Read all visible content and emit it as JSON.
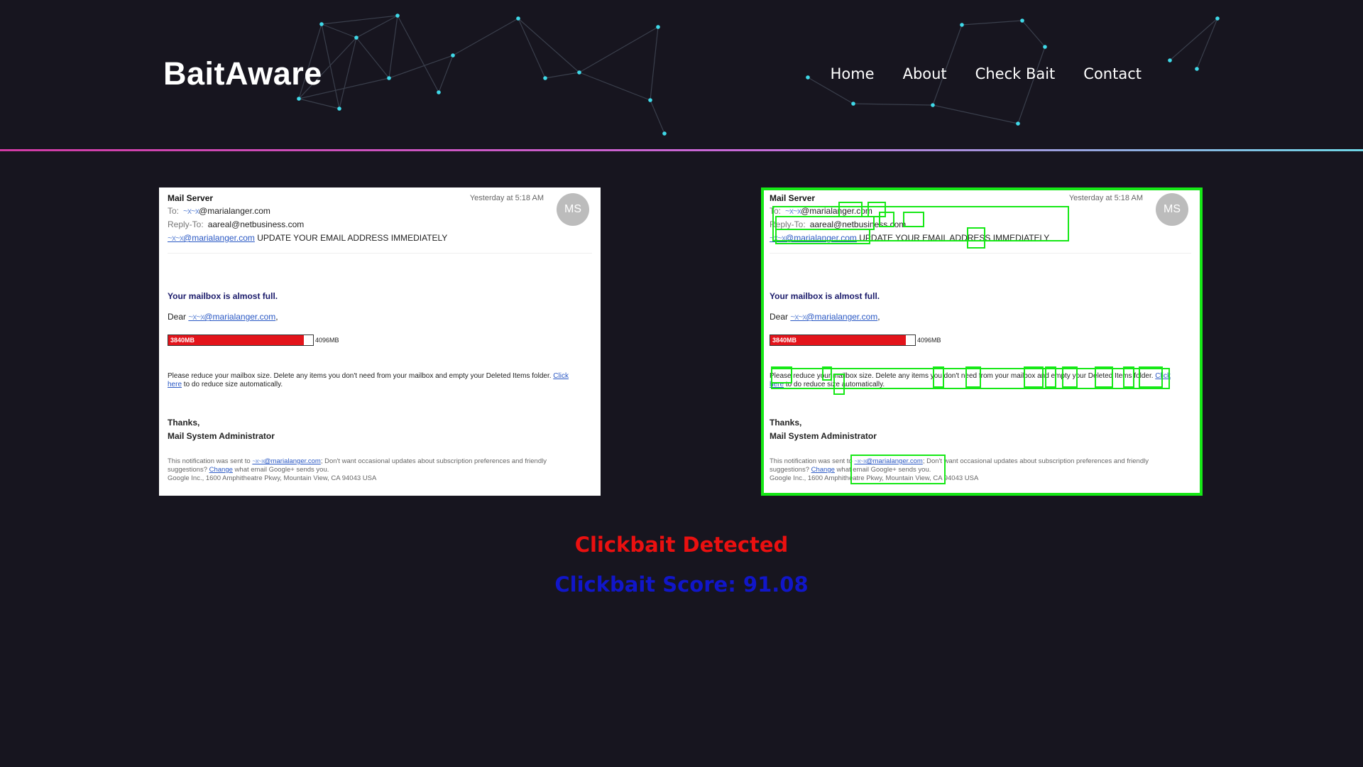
{
  "header": {
    "brand": "BaitAware",
    "nav": [
      {
        "label": "Home"
      },
      {
        "label": "About"
      },
      {
        "label": "Check Bait"
      },
      {
        "label": "Contact"
      }
    ]
  },
  "email": {
    "sender": "Mail Server",
    "timestamp": "Yesterday at 5:18 AM",
    "avatar": "MS",
    "to_label": "To:",
    "to_mask": "~x~x",
    "to_addr": "@marialanger.com",
    "reply_label": "Reply-To:",
    "reply_addr": "aareal@netbusiness.com",
    "subject_link": "@marialanger.com",
    "subject_text": "UPDATE YOUR EMAIL ADDRESS IMMEDIATELY",
    "heading": "Your mailbox is almost full.",
    "dear": "Dear",
    "dear_addr": "@marialanger.com",
    "used_label": "3840MB",
    "used_fraction": 0.9375,
    "capacity_label": "4096MB",
    "para_text": "Please reduce your mailbox size. Delete any items you don't need from your mailbox and empty your Deleted Items folder.",
    "para_link1": "Click",
    "para_link2": "here",
    "para_tail": "to do reduce size automatically.",
    "thanks": "Thanks,",
    "signature": "Mail System Administrator",
    "footer_pre": "This notification was sent to",
    "footer_addr": "@marialanger.com",
    "footer_mid": "; Don't want occasional updates about subscription preferences and friendly suggestions?",
    "footer_link": "Change",
    "footer_post": "what email Google+ sends you.",
    "footer_address": "Google Inc., 1600 Amphitheatre Pkwy, Mountain View, CA 94043 USA"
  },
  "result": {
    "status": "Clickbait Detected",
    "score": "Clickbait Score: 91.08",
    "status_color": "#ea1010",
    "score_color": "#1116c9",
    "highlight_color": "#16e816"
  }
}
